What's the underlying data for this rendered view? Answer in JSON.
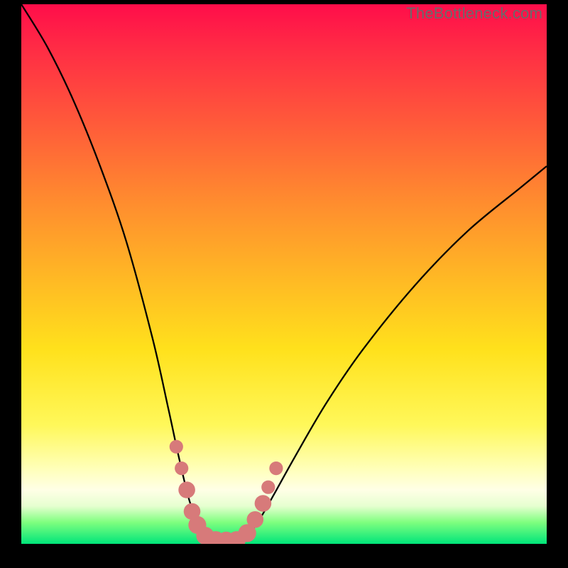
{
  "watermark": "TheBottleneck.com",
  "colors": {
    "frame_bg": "#000000",
    "curve_stroke": "#000000",
    "dot_fill": "#d77a7a",
    "gradient_top": "#ff0d4a",
    "gradient_bottom": "#00e57a"
  },
  "chart_data": {
    "type": "line",
    "title": "",
    "xlabel": "",
    "ylabel": "",
    "xlim": [
      0,
      100
    ],
    "ylim": [
      0,
      100
    ],
    "grid": false,
    "notes": "V-shaped bottleneck curve; y descends from ~100 on the left to ~0 near x≈36, flat valley to x≈42, then rises to ~70 at x=100. Dot markers cluster on the lower walls of the valley.",
    "series": [
      {
        "name": "curve-left",
        "x": [
          0,
          5,
          10,
          15,
          20,
          25,
          28,
          30,
          32,
          34,
          36
        ],
        "values": [
          100,
          92,
          82,
          70,
          56,
          38,
          25,
          16,
          8,
          3,
          0
        ]
      },
      {
        "name": "curve-right",
        "x": [
          42,
          45,
          48,
          52,
          58,
          65,
          75,
          85,
          95,
          100
        ],
        "values": [
          0,
          4,
          9,
          16,
          26,
          36,
          48,
          58,
          66,
          70
        ]
      }
    ],
    "valley_floor": {
      "x": [
        36,
        42
      ],
      "value": 0.5
    },
    "dots": [
      {
        "x": 29.5,
        "y": 18,
        "r": 1.3
      },
      {
        "x": 30.5,
        "y": 14,
        "r": 1.3
      },
      {
        "x": 31.5,
        "y": 10,
        "r": 1.6
      },
      {
        "x": 32.5,
        "y": 6,
        "r": 1.6
      },
      {
        "x": 33.5,
        "y": 3.5,
        "r": 1.7
      },
      {
        "x": 35.0,
        "y": 1.5,
        "r": 1.7
      },
      {
        "x": 37.0,
        "y": 0.7,
        "r": 1.7
      },
      {
        "x": 39.0,
        "y": 0.6,
        "r": 1.7
      },
      {
        "x": 41.0,
        "y": 0.7,
        "r": 1.7
      },
      {
        "x": 43.0,
        "y": 2.0,
        "r": 1.7
      },
      {
        "x": 44.5,
        "y": 4.5,
        "r": 1.6
      },
      {
        "x": 46.0,
        "y": 7.5,
        "r": 1.6
      },
      {
        "x": 47.0,
        "y": 10.5,
        "r": 1.3
      },
      {
        "x": 48.5,
        "y": 14.0,
        "r": 1.3
      }
    ]
  }
}
